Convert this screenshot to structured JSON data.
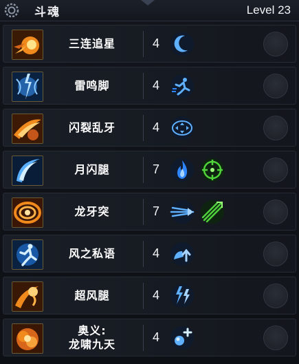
{
  "header": {
    "title": "斗魂",
    "level": "Level 23"
  },
  "colors": {
    "fire": "#f08a1c",
    "ice": "#3b8fe0",
    "green": "#4fd23a",
    "effect_blue": "#2d86ff"
  },
  "skills": [
    {
      "name": "三连追星",
      "count": "4",
      "icon": "fire-meteor-icon",
      "effects": [
        "crescent-moon-icon"
      ]
    },
    {
      "name": "雷鸣脚",
      "count": "4",
      "icon": "lightning-kick-icon",
      "effects": [
        "running-man-icon"
      ]
    },
    {
      "name": "闪裂乱牙",
      "count": "4",
      "icon": "fire-slash-icon",
      "effects": [
        "target-arrows-icon"
      ]
    },
    {
      "name": "月闪腿",
      "count": "7",
      "icon": "crescent-kick-icon",
      "effects": [
        "blue-flame-icon",
        "green-target-icon"
      ]
    },
    {
      "name": "龙牙突",
      "count": "7",
      "icon": "fire-spiral-icon",
      "effects": [
        "speed-lines-icon",
        "green-sword-burst-icon"
      ]
    },
    {
      "name": "风之私语",
      "count": "4",
      "icon": "wind-runner-icon",
      "effects": [
        "dash-up-icon"
      ]
    },
    {
      "name": "超风腿",
      "count": "4",
      "icon": "fire-whirl-icon",
      "effects": [
        "lightning-bolts-icon"
      ]
    },
    {
      "name": "奥义:\n龙啸九天",
      "count": "4",
      "icon": "fire-explosion-icon",
      "effects": [
        "orb-plus-icon"
      ]
    }
  ]
}
